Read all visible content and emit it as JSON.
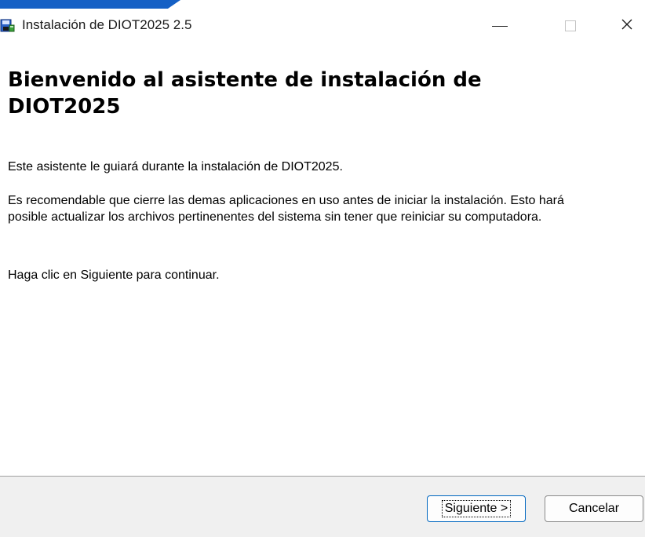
{
  "window": {
    "title": "Instalación de DIOT2025 2.5",
    "icon": "installer-icon",
    "controls": {
      "minimize": "−",
      "maximize": "☐",
      "close": "✕"
    }
  },
  "content": {
    "heading": "Bienvenido al asistente de instalación de DIOT2025",
    "paragraphs": [
      "Este asistente le guiará durante la instalación de DIOT2025.",
      "Es recomendable que cierre las demas aplicaciones en uso antes de iniciar la instalación. Esto hará posible actualizar los archivos pertinenentes del sistema sin tener que reiniciar su computadora.",
      "Haga clic en Siguiente para continuar."
    ]
  },
  "footer": {
    "next_label": "Siguiente >",
    "cancel_label": "Cancelar"
  },
  "colors": {
    "accent": "#1560c5",
    "footer_bg": "#f0f0f0",
    "focus_border": "#0067c0"
  }
}
